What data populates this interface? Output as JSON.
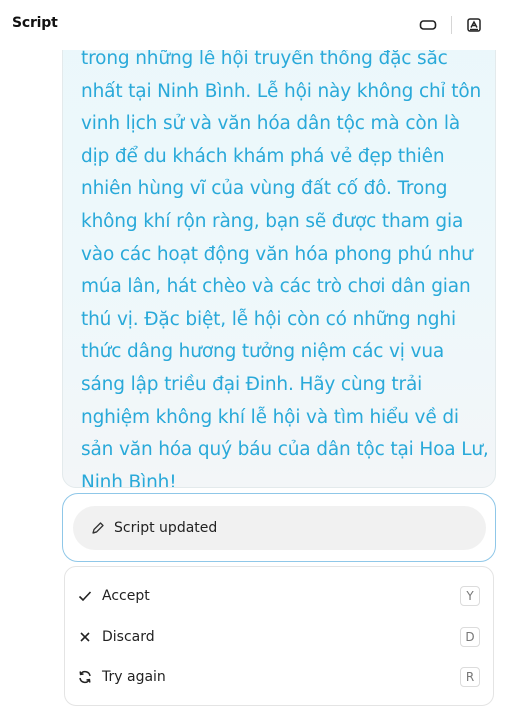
{
  "header": {
    "title": "Script",
    "icons": [
      "window-icon",
      "export-icon"
    ]
  },
  "message": {
    "text": "trong những lễ hội truyền thống đặc sắc nhất tại Ninh Bình. Lễ hội này không chỉ tôn vinh lịch sử và văn hóa dân tộc mà còn là dịp để du khách khám phá vẻ đẹp thiên nhiên hùng vĩ của vùng đất cố đô. Trong không khí rộn ràng, bạn sẽ được tham gia vào các hoạt động văn hóa phong phú như múa lân, hát chèo và các trò chơi dân gian thú vị. Đặc biệt, lễ hội còn có những nghi thức dâng hương tưởng niệm các vị vua sáng lập triều đại Đinh. Hãy cùng trải nghiệm không khí lễ hội và tìm hiểu về di sản văn hóa quý báu của dân tộc tại Hoa Lư, Ninh Bình!",
    "color": "#29a9d9"
  },
  "status": {
    "label": "Script updated",
    "icon": "pencil-icon"
  },
  "actions": [
    {
      "label": "Accept",
      "shortcut": "Y",
      "icon": "check-icon"
    },
    {
      "label": "Discard",
      "shortcut": "D",
      "icon": "close-icon"
    },
    {
      "label": "Try again",
      "shortcut": "R",
      "icon": "refresh-icon"
    }
  ]
}
